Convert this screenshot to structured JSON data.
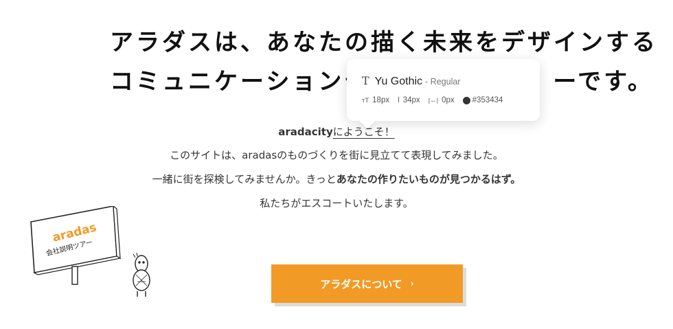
{
  "headline": {
    "line1": "アラダスは、あなたの描く未来をデザインする",
    "line2": "コミュニケーションデ　　　　　　　ーです。"
  },
  "tooltip": {
    "type_icon": "text-type-icon",
    "font_name": "Yu Gothic",
    "font_style": "- Regular",
    "font_size": "18px",
    "line_height": "34px",
    "letter_spacing": "0px",
    "color_value": "#353434"
  },
  "intro": {
    "brand": "aradacity",
    "welcome": "にようこそ！",
    "line2": "このサイトは、aradasのものづくりを街に見立てて表現してみました。",
    "line3_prefix": "一緒に街を探検してみませんか。きっと",
    "line3_bold": "あなたの作りたいものが見つかるはず。",
    "line4": "私たちがエスコートいたします。"
  },
  "sign": {
    "title": "aradas",
    "subtitle": "会社説明ツアー"
  },
  "cta": {
    "label": "アラダスについて",
    "arrow": "›"
  },
  "colors": {
    "accent": "#f29a26",
    "text": "#353434"
  }
}
